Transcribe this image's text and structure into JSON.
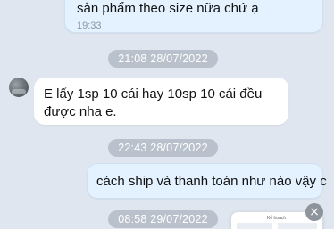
{
  "messages": [
    {
      "direction": "out",
      "text": "sản phẩm theo size nữa chứ ạ",
      "time": "19:33"
    },
    {
      "direction": "in",
      "text": "E lấy 1sp 10 cái hay 10sp 10 cái đều được nha e."
    },
    {
      "direction": "out",
      "text": "cách ship và thanh toán như nào vậy c"
    }
  ],
  "dates": [
    "21:08 28/07/2022",
    "22:43 28/07/2022",
    "08:58 29/07/2022"
  ],
  "preview": {
    "title": "Kế hoạch"
  },
  "icons": {
    "close": "×"
  },
  "colors": {
    "background": "#dfe6ef",
    "outgoing_bubble": "#e4f1ff",
    "incoming_bubble": "#ffffff",
    "date_pill": "#b9c1cd"
  }
}
